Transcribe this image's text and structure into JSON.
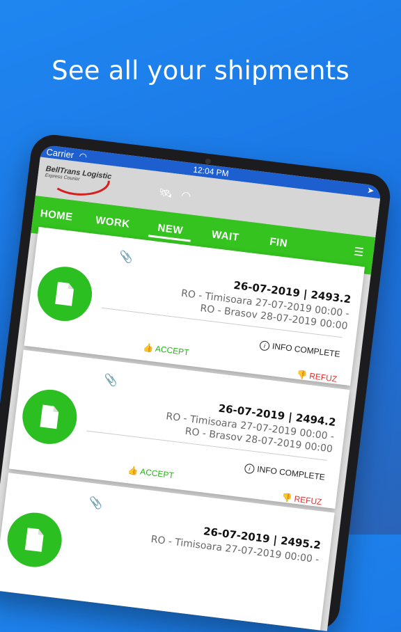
{
  "headline": "See all your shipments",
  "status_bar": {
    "carrier": "Carrier",
    "time": "12:04 PM",
    "icons": [
      "wifi-icon",
      "location-arrow-icon"
    ]
  },
  "app": {
    "logo": {
      "name": "BellTrans Logistic",
      "tagline": "Express Courier"
    },
    "tabs": [
      {
        "label": "HOME"
      },
      {
        "label": "WORK"
      },
      {
        "label": "NEW",
        "active": true
      },
      {
        "label": "WAIT"
      },
      {
        "label": "FIN"
      }
    ]
  },
  "shipments": [
    {
      "header": "26-07-2019 | 2493.2",
      "origin": "RO - Timisoara 27-07-2019 00:00 -",
      "destination": "RO - Brasov 28-07-2019 00:00",
      "info": "INFO COMPLETE",
      "accept": "ACCEPT",
      "refuse": "REFUZ"
    },
    {
      "header": "26-07-2019 | 2494.2",
      "origin": "RO - Timisoara 27-07-2019 00:00 -",
      "destination": "RO - Brasov 28-07-2019 00:00",
      "info": "INFO COMPLETE",
      "accept": "ACCEPT",
      "refuse": "REFUZ"
    },
    {
      "header": "26-07-2019 | 2495.2",
      "origin": "RO - Timisoara 27-07-2019 00:00 -",
      "destination": "",
      "info": "",
      "accept": "",
      "refuse": ""
    }
  ],
  "colors": {
    "accent_green": "#34c31f",
    "refuse_red": "#e23030",
    "status_blue": "#1e5fd0"
  }
}
